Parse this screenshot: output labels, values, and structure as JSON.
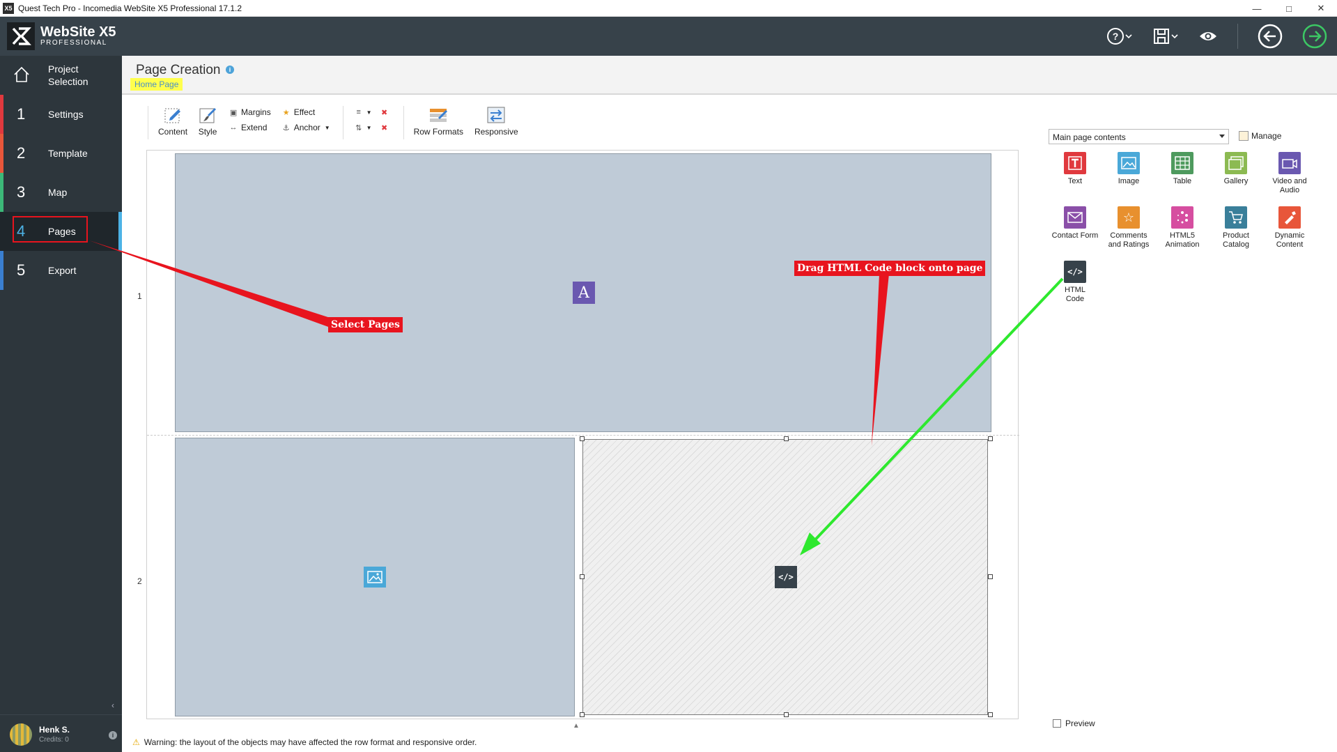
{
  "window": {
    "title": "Quest Tech Pro - Incomedia WebSite X5 Professional 17.1.2",
    "icon_text": "X5",
    "controls": [
      "minimize-icon",
      "maximize-icon",
      "close-icon"
    ]
  },
  "brand": {
    "name": "WebSite X5",
    "edition": "PROFESSIONAL"
  },
  "top_actions": [
    "help-icon",
    "save-icon",
    "preview-eye-icon",
    "back-arrow-icon",
    "forward-arrow-icon"
  ],
  "sidebar": {
    "items": [
      {
        "num": "",
        "label": "Project Selection",
        "icon": "home-icon",
        "accent": "#2d363c"
      },
      {
        "num": "1",
        "label": "Settings",
        "accent": "#e0393e"
      },
      {
        "num": "2",
        "label": "Template",
        "accent": "#e8563a"
      },
      {
        "num": "3",
        "label": "Map",
        "accent": "#3cb878"
      },
      {
        "num": "4",
        "label": "Pages",
        "accent": "#4db3e6"
      },
      {
        "num": "5",
        "label": "Export",
        "accent": "#3a7fd0"
      }
    ],
    "user": {
      "name": "Henk S.",
      "credits": "Credits: 0"
    }
  },
  "page": {
    "title": "Page Creation",
    "breadcrumb": "Home Page"
  },
  "toolbar": {
    "content": "Content",
    "style": "Style",
    "margins": "Margins",
    "extend": "Extend",
    "effect": "Effect",
    "anchor": "Anchor",
    "row_formats": "Row Formats",
    "responsive": "Responsive"
  },
  "canvas": {
    "row1": "1",
    "row2": "2"
  },
  "right_panel": {
    "select_value": "Main page contents",
    "manage": "Manage",
    "objects": [
      {
        "label": "Text",
        "color": "#e0393e",
        "icon": "text-object-icon"
      },
      {
        "label": "Image",
        "color": "#4aa8d8",
        "icon": "image-object-icon"
      },
      {
        "label": "Table",
        "color": "#4e9a5e",
        "icon": "table-object-icon"
      },
      {
        "label": "Gallery",
        "color": "#8cba52",
        "icon": "gallery-object-icon"
      },
      {
        "label": "Video and Audio",
        "color": "#6a58b0",
        "icon": "video-object-icon"
      },
      {
        "label": "Contact Form",
        "color": "#8a4fa8",
        "icon": "contact-form-icon"
      },
      {
        "label": "Comments and Ratings",
        "color": "#e8902e",
        "icon": "comments-icon"
      },
      {
        "label": "HTML5 Animation",
        "color": "#d64ea0",
        "icon": "animation-icon"
      },
      {
        "label": "Product Catalog",
        "color": "#3a7f9a",
        "icon": "catalog-icon"
      },
      {
        "label": "Dynamic Content",
        "color": "#e8563a",
        "icon": "dynamic-content-icon"
      },
      {
        "label": "HTML Code",
        "color": "#37424a",
        "icon": "html-code-icon"
      }
    ],
    "preview": "Preview"
  },
  "status": {
    "warning": "Warning: the layout of the objects may have affected the row format and responsive order."
  },
  "annotations": {
    "select_pages": "Select Pages",
    "drag_html": "Drag HTML Code block onto page"
  },
  "colors": {
    "annotation_red": "#e8141e",
    "annotation_green": "#2ee82e",
    "breadcrumb_highlight": "#ffff4d"
  }
}
